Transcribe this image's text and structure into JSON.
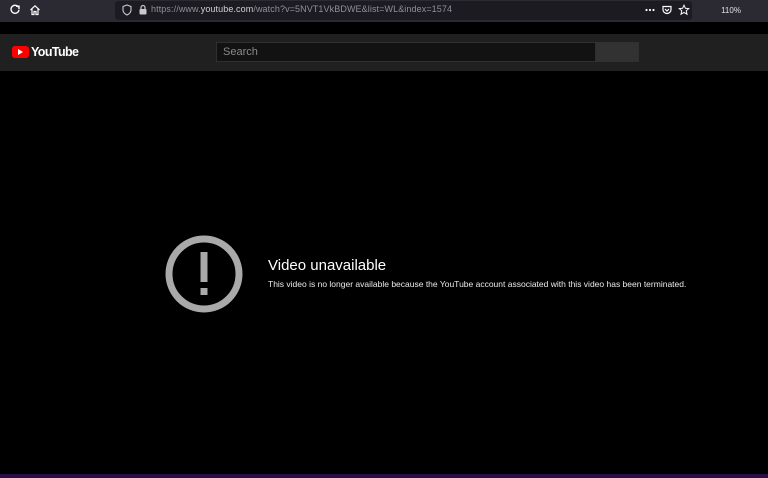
{
  "browser": {
    "url_prefix": "https://www.",
    "url_domain": "youtube.com",
    "url_suffix": "/watch?v=5NVT1VkBDWE&list=WL&index=1574",
    "zoom": "110%",
    "icons": [
      "reload-icon",
      "home-icon",
      "shield-icon",
      "lock-icon",
      "dots-icon",
      "pocket-icon",
      "star-icon"
    ]
  },
  "header": {
    "logo_text": "YouTube",
    "search_placeholder": "Search"
  },
  "player": {
    "title": "Video unavailable",
    "message": "This video is no longer available because the YouTube account associated with this video has been terminated."
  },
  "colors": {
    "brand_red": "#ff0000",
    "header_bg": "#202020",
    "player_bg": "#000000",
    "icon_gray": "#a9a9a9",
    "bottom_strip": "#2a0f45"
  }
}
